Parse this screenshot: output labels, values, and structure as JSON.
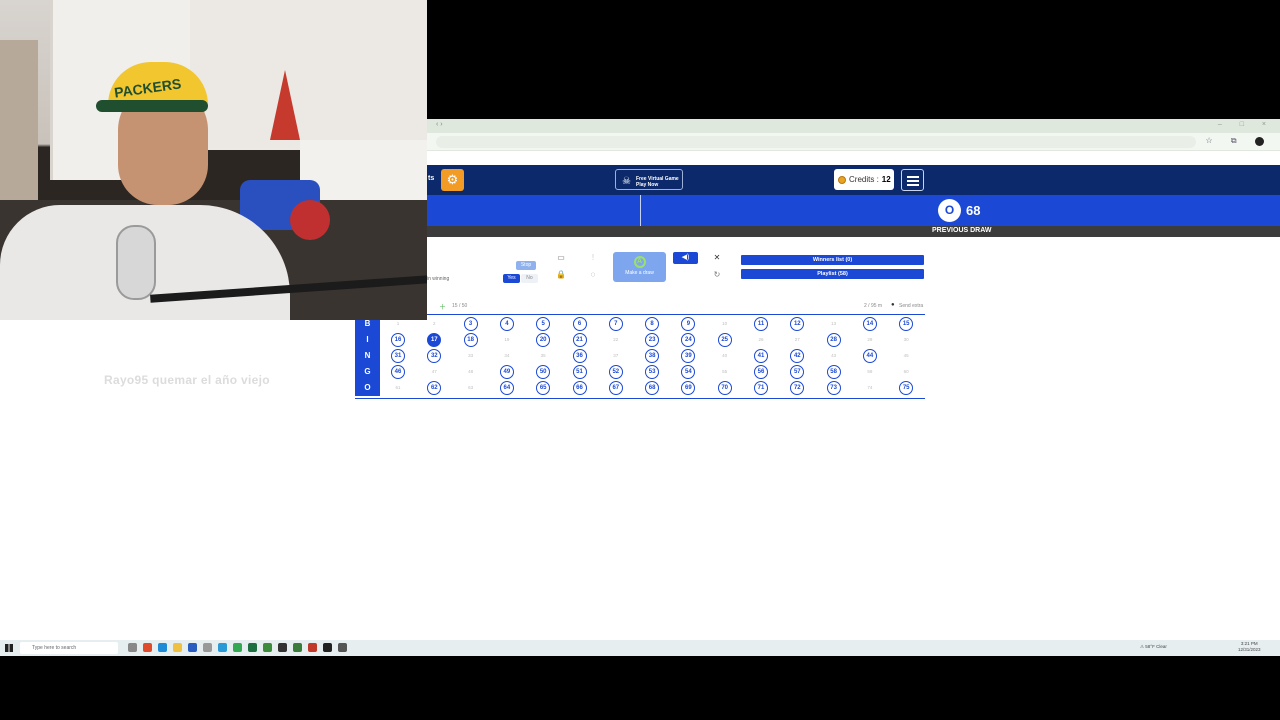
{
  "browser": {
    "tab_nav": "‹ ›",
    "window_controls": "– □ ×"
  },
  "site": {
    "promo": {
      "line1": "Free Virtual Game",
      "line2": "Play Now"
    },
    "credits_label": "Credits :",
    "credits_value": "12"
  },
  "draw": {
    "current_letter": "O",
    "current_number": "68",
    "previous_label": "PREVIOUS DRAW"
  },
  "controls": {
    "auto_win_label": "in winning",
    "stop_label": "Stop",
    "yes_label": "Yes",
    "no_label": "No",
    "make_draw_label": "Make a draw",
    "winners_label": "Winners list (0)",
    "playlist_label": "Playlist (58)",
    "players_count": "15 / 50",
    "card_info_left": "2 / 95 m",
    "card_info_right": "Send extra"
  },
  "card": {
    "letters": [
      "B",
      "I",
      "N",
      "G",
      "O"
    ],
    "current": 17,
    "called": [
      3,
      4,
      5,
      6,
      7,
      8,
      9,
      11,
      12,
      14,
      15,
      16,
      17,
      18,
      20,
      21,
      23,
      24,
      25,
      28,
      31,
      32,
      36,
      38,
      39,
      41,
      42,
      44,
      46,
      49,
      50,
      51,
      52,
      53,
      54,
      56,
      57,
      58,
      62,
      64,
      65,
      66,
      67,
      68,
      69,
      70,
      71,
      72,
      73,
      75
    ]
  },
  "overlay": {
    "text": "Rayo95  quemar el año viejo"
  },
  "webcam": {
    "hat_text": "PACKERS"
  },
  "taskbar": {
    "search_placeholder": "Type here to search",
    "tray": "⚠ 58°F Clear",
    "time": "3:21 PM",
    "date": "12/31/2023"
  },
  "colors": {
    "primary": "#1b49d6",
    "navy": "#0c2a6b",
    "orange": "#f29b25",
    "green": "#9be06a"
  }
}
